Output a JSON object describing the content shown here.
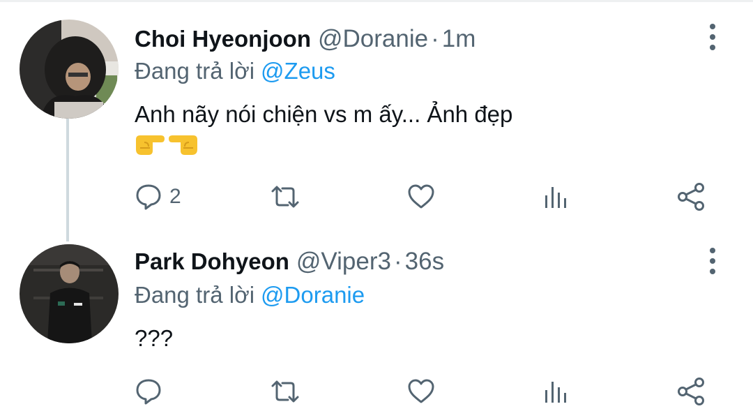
{
  "tweets": [
    {
      "display_name": "Choi Hyeonjoon",
      "handle": "@Doranie",
      "separator": "·",
      "time": "1m",
      "reply_prefix": "Đang trả lời",
      "reply_to": "@Zeus",
      "text": "Anh nãy nói chiện vs m ấy... Ảnh đẹp",
      "emoji": [
        "pointing-right-hand",
        "pointing-left-hand"
      ],
      "reply_count": "2",
      "avatar": "profile-photo-hooded"
    },
    {
      "display_name": "Park Dohyeon",
      "handle": "@Viper3",
      "separator": "·",
      "time": "36s",
      "reply_prefix": "Đang trả lời",
      "reply_to": "@Doranie",
      "text": "???",
      "emoji": [],
      "reply_count": "",
      "avatar": "profile-photo-dark"
    }
  ],
  "icons": {
    "reply": "speech-bubble-icon",
    "retweet": "retweet-icon",
    "like": "heart-icon",
    "stats": "bar-chart-icon",
    "share": "share-icon",
    "more": "vertical-ellipsis-icon"
  },
  "colors": {
    "text_primary": "#0f1419",
    "text_secondary": "#536471",
    "accent": "#1d9bf0",
    "thread_line": "#cfd9de",
    "emoji_yellow": "#f7c22e"
  }
}
